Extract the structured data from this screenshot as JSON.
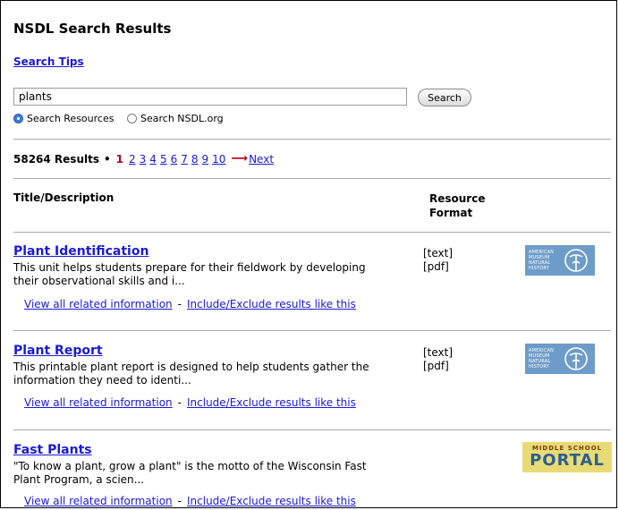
{
  "header": {
    "title": "NSDL Search Results",
    "search_tips": "Search Tips"
  },
  "search": {
    "query": "plants",
    "button_label": "Search",
    "scope_options": [
      {
        "label": "Search Resources",
        "selected": true
      },
      {
        "label": "Search NSDL.org",
        "selected": false
      }
    ]
  },
  "results_bar": {
    "count_label": "58264 Results",
    "bullet": "•",
    "current_page": "1",
    "pages": [
      "2",
      "3",
      "4",
      "5",
      "6",
      "7",
      "8",
      "9",
      "10"
    ],
    "next_label": "Next"
  },
  "columns": {
    "title": "Title/Description",
    "format_line1": "Resource",
    "format_line2": "Format"
  },
  "results": [
    {
      "title": "Plant Identification",
      "desc_line1": "This unit helps students prepare for their fieldwork by developing",
      "desc_line2": "their observational skills and i...",
      "formats": [
        "[text]",
        "[pdf]"
      ],
      "logo": "amnh-logo",
      "related_link": "View all related information",
      "separator": "-",
      "include_link": "Include/Exclude results like this"
    },
    {
      "title": "Plant Report",
      "desc_line1": "This printable plant report is designed to help students gather the",
      "desc_line2": "information they need to identi...",
      "formats": [
        "[text]",
        "[pdf]"
      ],
      "logo": "amnh-logo",
      "related_link": "View all related information",
      "separator": "-",
      "include_link": "Include/Exclude results like this"
    },
    {
      "title": "Fast Plants",
      "desc_line1": "\"To know a plant, grow a plant\" is the motto of the Wisconsin Fast",
      "desc_line2": "Plant Program, a scien...",
      "formats": [],
      "logo": "middle-school-portal-logo",
      "related_link": "View all related information",
      "separator": "-",
      "include_link": "Include/Exclude results like this"
    }
  ],
  "logos": {
    "amnh_lines": [
      "AMERICAN",
      "MUSEUM",
      "NATURAL",
      "HISTORY"
    ],
    "msp_top": "MIDDLE SCHOOL",
    "msp_main": "PORTAL"
  },
  "colors": {
    "link": "#1a1ad6",
    "current_page": "#b3001b",
    "amnh_blue": "#6e9cc8",
    "portal_yellow": "#e8db76"
  }
}
